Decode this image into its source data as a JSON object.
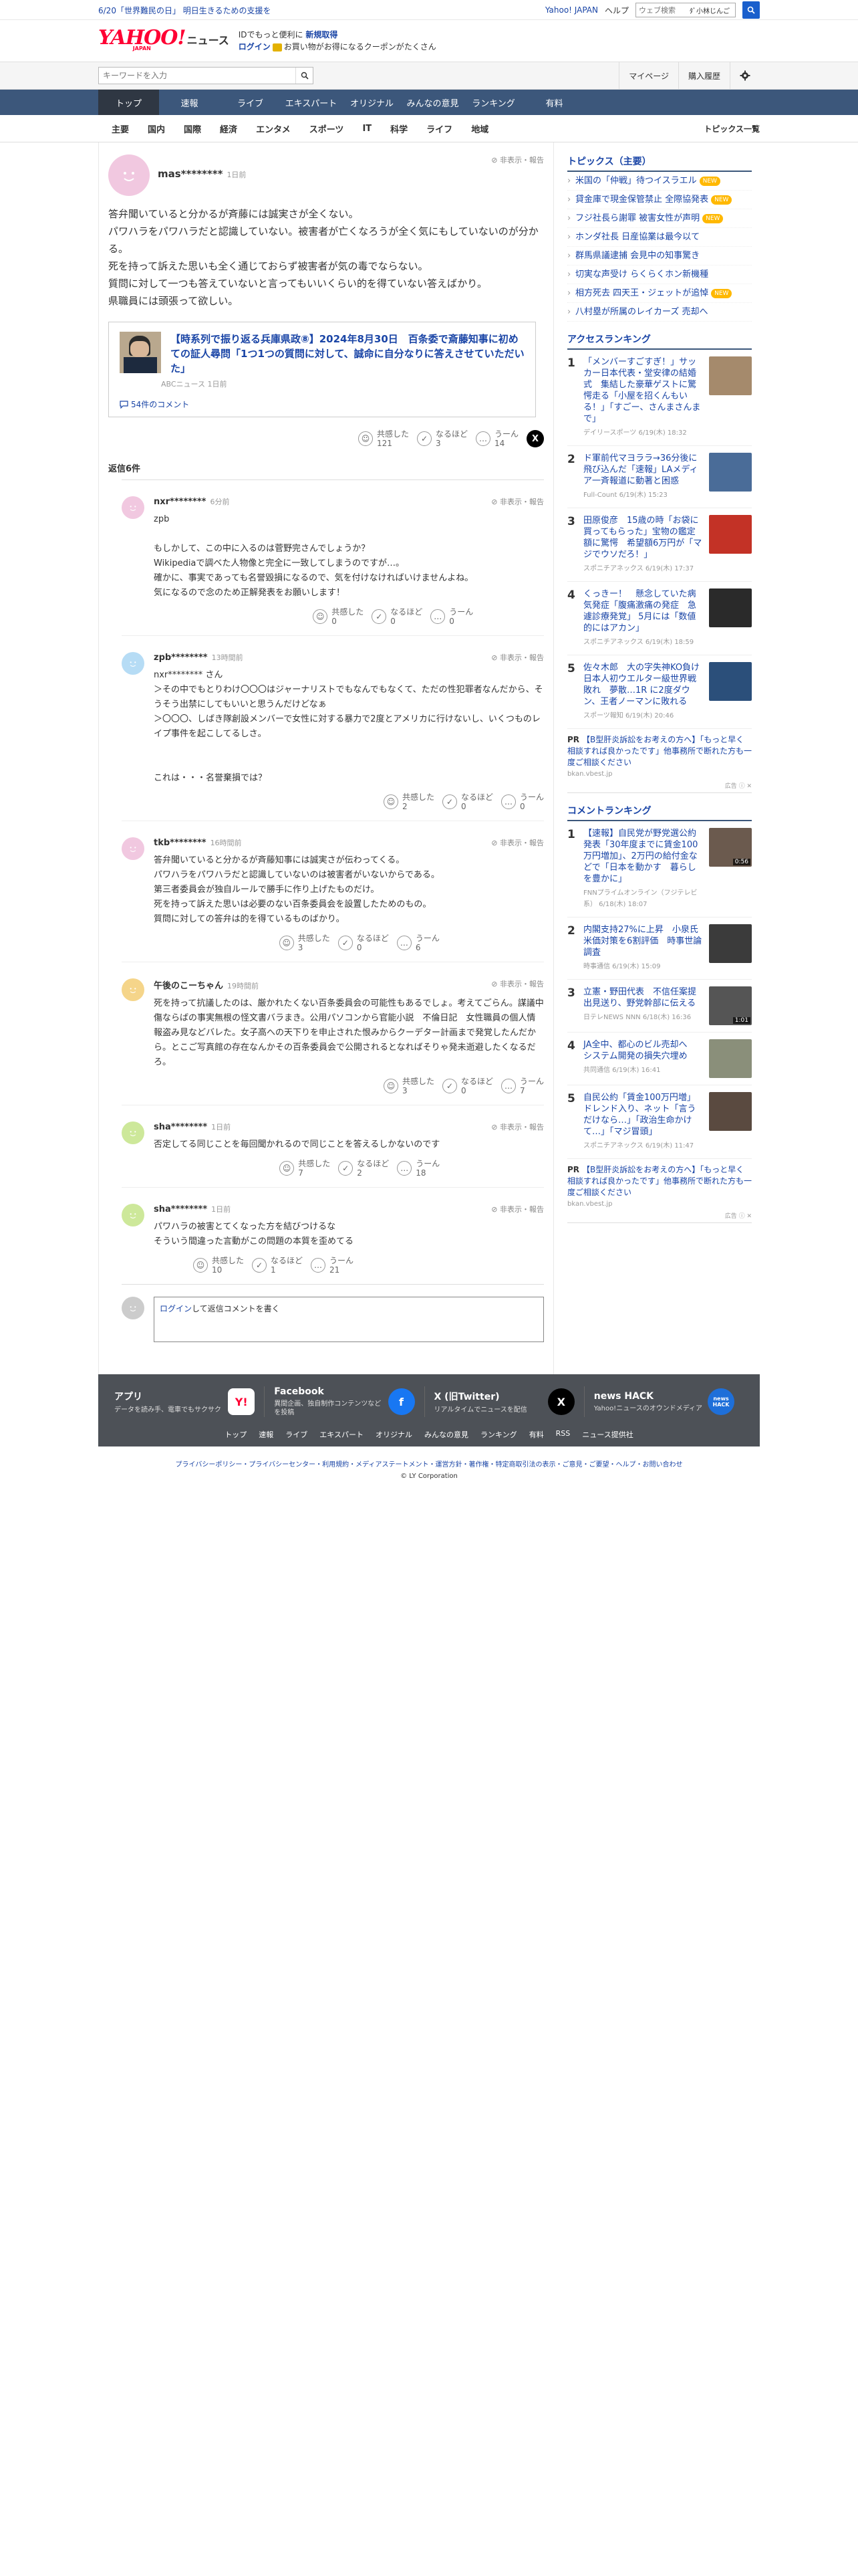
{
  "topbar": {
    "promo": "6/20「世界難民の日」 明日生きるための支援を",
    "links": [
      "Yahoo! JAPAN",
      "ヘルプ"
    ],
    "search_placeholder": "ウェブ検索",
    "search_pill": "ﾀﾞ小林じんご"
  },
  "header": {
    "logo_main": "YAHOO!",
    "logo_sub": "JAPAN",
    "logo_news": "ニュース",
    "msg_line1": "IDでもっと便利に",
    "msg_line1_link": "新規取得",
    "msg_login": "ログイン",
    "msg_line2": "お買い物がお得になるクーポンがたくさん"
  },
  "searchrow": {
    "placeholder": "キーワードを入力",
    "mypage": "マイページ",
    "history": "購入履歴"
  },
  "gnav": [
    "トップ",
    "速報",
    "ライブ",
    "エキスパート",
    "オリジナル",
    "みんなの意見",
    "ランキング",
    "有料"
  ],
  "subnav": {
    "items": [
      "主要",
      "国内",
      "国際",
      "経済",
      "エンタメ",
      "スポーツ",
      "IT",
      "科学",
      "ライフ",
      "地域"
    ],
    "all": "トピックス一覧"
  },
  "main_comment": {
    "user": "mas********",
    "time": "1日前",
    "hide": "非表示・報告",
    "text": "答弁聞いていると分かるが斉藤には誠実さが全くない。\nパワハラをパワハラだと認識していない。被害者が亡くなろうが全く気にもしていないのが分かる。\n死を持って訴えた思いも全く通じておらず被害者が気の毒でならない。\n質問に対して一つも答えていないと言ってもいいくらい的を得ていない答えばかり。\n県職員には頭張って欲しい。",
    "reactions": [
      {
        "label": "共感した",
        "count": "121",
        "icon": "smile"
      },
      {
        "label": "なるほど",
        "count": "3",
        "icon": "check"
      },
      {
        "label": "うーん",
        "count": "14",
        "icon": "hmm"
      }
    ],
    "x_share": "X"
  },
  "article": {
    "title": "【時系列で振り返る兵庫県政⑧】2024年8月30日　百条委で斎藤知事に初めての証人尋問「1つ1つの質問に対して、誠命に自分なりに答えさせていただいた」",
    "source": "ABCニュース 1日前",
    "comments": "54件のコメント"
  },
  "reply_count_label": "返信",
  "reply_count": "6件",
  "replies": [
    {
      "user": "nxr********",
      "time": "6分前",
      "text": "zpb\n\nもしかして、この中に入るのは菅野完さんでしょうか？\nWikipediaで調べた人物像と完全に一致してしまうのですが…。\n確かに、事実であっても名誉毀損になるので、気を付けなければいけませんよね。\n気になるので念のため正解発表をお願いします！",
      "reactions": [
        "0",
        "0",
        "0"
      ],
      "avatar": "#f1c8e0"
    },
    {
      "user": "zpb********",
      "time": "13時間前",
      "text": "nxr******** さん\n＞その中でもとりわけ〇〇〇はジャーナリストでもなんでもなくて、ただの性犯罪者なんだから、そうそう出禁にしてもいいと思うんだけどなぁ\n＞〇〇〇、しばき隊創設メンバーで女性に対する暴力で2度とアメリカに行けないし、いくつものレイプ事件を起こしてるしさ。\n\n\nこれは・・・名誉棄損では？",
      "reactions": [
        "2",
        "0",
        "0"
      ],
      "avatar": "#b6dcf5"
    },
    {
      "user": "tkb********",
      "time": "16時間前",
      "text": "答弁聞いていると分かるが斉藤知事には誠実さが伝わってくる。\nパワハラをパワハラだと認識していないのは被害者がいないからである。\n第三者委員会が独自ルールで勝手に作り上げたものだけ。\n死を持って訴えた思いは必要のない百条委員会を設置したためのもの。\n質問に対しての答弁は的を得ているものばかり。",
      "reactions": [
        "3",
        "0",
        "6"
      ],
      "avatar": "#f1c8e0"
    },
    {
      "user": "午後のこーちゃん",
      "time": "19時間前",
      "text": "死を持って抗議したのは、厳かれたくない百条委員会の可能性もあるでしょ。考えてごらん。謀議中傷ならばの事実無根の怪文書バラまき。公用パソコンから官能小説　不倫日記　女性職員の個人情報盗み見などバレた。女子高への天下りを申止された恨みからクーデター計画まで発覚したんだから。とこご写真館の存在なんかその百条委員会で公開されるとなればそりゃ発未逝避したくなるだろ。",
      "reactions": [
        "3",
        "0",
        "7"
      ],
      "avatar": "#f5d58a"
    },
    {
      "user": "sha********",
      "time": "1日前",
      "text": "否定してる同じことを毎回聞かれるので同じことを答えるしかないのです",
      "reactions": [
        "7",
        "2",
        "18"
      ],
      "avatar": "#cde89a"
    },
    {
      "user": "sha********",
      "time": "1日前",
      "text": "パワハラの被害とてくなった方を結びつけるな\nそういう間違った言動がこの問題の本質を歪めてる",
      "reactions": [
        "10",
        "1",
        "21"
      ],
      "avatar": "#cde89a"
    }
  ],
  "reply_form": {
    "login": "ログイン",
    "text": "して返信コメントを書く"
  },
  "reaction_labels": [
    "共感した",
    "なるほど",
    "うーん"
  ],
  "sidebar": {
    "topics_title": "トピックス（主要）",
    "topics": [
      {
        "text": "米国の「仲戦」待つイスラエル",
        "new": true
      },
      {
        "text": "貸金庫で現金保管禁止 全際協発表",
        "new": true
      },
      {
        "text": "フジ社長ら謝罪 被害女性が声明",
        "new": true
      },
      {
        "text": "ホンダ社長 日産協業は最今以て",
        "new": false
      },
      {
        "text": "群馬県議逮捕 会見中の知事驚き",
        "new": false
      },
      {
        "text": "切実な声受け らくらくホン新機種",
        "new": false
      },
      {
        "text": "相方死去 四天王・ジェットが追悼",
        "new": true
      },
      {
        "text": "八村塁が所属のレイカーズ 売却へ",
        "new": false
      }
    ],
    "new_label": "NEW",
    "access_title": "アクセスランキング",
    "access": [
      {
        "no": "1",
        "text": "「メンバーすごすぎ！」サッカー日本代表・堂安律の結婚式　集結した豪華ゲストに驚愕走る「小屋を招くんもいる！」「すごー、さんまさんまで」",
        "meta": "デイリースポーツ 6/19(木) 18:32",
        "color": "#a58a6c"
      },
      {
        "no": "2",
        "text": "ド軍前代マヨララ→36分後に飛び込んだ「速報」LAメディア一斉報道に動著と困惑",
        "meta": "Full-Count 6/19(木) 15:23",
        "color": "#4a6c98"
      },
      {
        "no": "3",
        "text": "田原俊彦　15歳の時「お袋に買ってもらった」宝物の鑑定額に驚愕　希望額6万円が「マジでウソだろ！」",
        "meta": "スポニチアネックス 6/19(木) 17:37",
        "color": "#c33226"
      },
      {
        "no": "4",
        "text": "くっきー！　懸念していた病気発症「腹痛激痛の発症　急遽診療発覚」 5月には「数値的にはアカン」",
        "meta": "スポニチアネックス 6/19(木) 18:59",
        "color": "#2a2a2a"
      },
      {
        "no": "5",
        "text": "佐々木郎　大の字失神KO負け　日本人初ウエルター級世界戦敗れ　夢散…1R に2度ダウン、王者ノーマンに敗れる",
        "meta": "スポーツ報知 6/19(木) 20:46",
        "color": "#2b4f7a"
      }
    ],
    "pr1": {
      "tag": "PR",
      "title": "【B型肝炎訴訟をお考えの方へ】「もっと早く相談すれば良かったです」他事務所で断れた方も一度ご相談ください",
      "domain": "bkan.vbest.jp"
    },
    "adtag": "広告",
    "comment_title": "コメントランキング",
    "comment": [
      {
        "no": "1",
        "text": "【速報】自民党が野党選公約発表「30年度までに賃金100万円増加」、2万円の給付金などで「日本を動かす　暮らしを豊かに」",
        "meta": "FNNプライムオンライン（フジテレビ系） 6/18(木) 18:07",
        "color": "#6b5a4e",
        "badge": "0:56"
      },
      {
        "no": "2",
        "text": "内閣支持27%に上昇　小泉氏米価対策を6割評価　時事世論調査",
        "meta": "時事通信 6/19(木) 15:09",
        "color": "#3b3b3b",
        "badge": ""
      },
      {
        "no": "3",
        "text": "立憲・野田代表　不信任案提出見送り、野党幹部に伝える",
        "meta": "日テレNEWS NNN 6/18(木) 16:36",
        "color": "#555555",
        "badge": "1:01"
      },
      {
        "no": "4",
        "text": "JA全中、都心のビル売却へ　システム開発の損失穴埋め",
        "meta": "共同通信 6/19(木) 16:41",
        "color": "#8a8f7a",
        "badge": ""
      },
      {
        "no": "5",
        "text": "自民公約「賃金100万円増」ドレンド入り、ネット「言うだけなら…」「政治生命かけて…」「マジ冒頭」",
        "meta": "スポニチアネックス 6/19(木) 11:47",
        "color": "#5a4a40",
        "badge": ""
      }
    ],
    "pr2": {
      "tag": "PR",
      "title": "【B型肝炎訴訟をお考えの方へ】「もっと早く相談すれば良かったです」他事務所で断れた方も一度ご相談ください",
      "domain": "bkan.vbest.jp"
    }
  },
  "footer": {
    "cols": [
      {
        "title": "アプリ",
        "desc": "データを読み手、電車でもサクサク",
        "icon": "Y!"
      },
      {
        "title": "Facebook",
        "desc": "異間企画、独自制作コンテンツなどを投稿",
        "icon": "f"
      },
      {
        "title": "X (旧Twitter)",
        "desc": "リアルタイムでニュースを配信",
        "icon": "X"
      },
      {
        "title": "news HACK",
        "desc": "Yahoo!ニュースのオウンドメディア",
        "icon": "news HACK"
      }
    ],
    "links": [
      "トップ",
      "速報",
      "ライブ",
      "エキスパート",
      "オリジナル",
      "みんなの意見",
      "ランキング",
      "有料",
      "RSS",
      "ニュース提供社"
    ],
    "bottom": "プライバシーポリシー・プライバシーセンター・利用規約・メディアステートメント・運営方針・著作権・特定商取引法の表示・ご意見・ご要望・ヘルプ・お問い合わせ",
    "copyright": "© LY Corporation"
  }
}
